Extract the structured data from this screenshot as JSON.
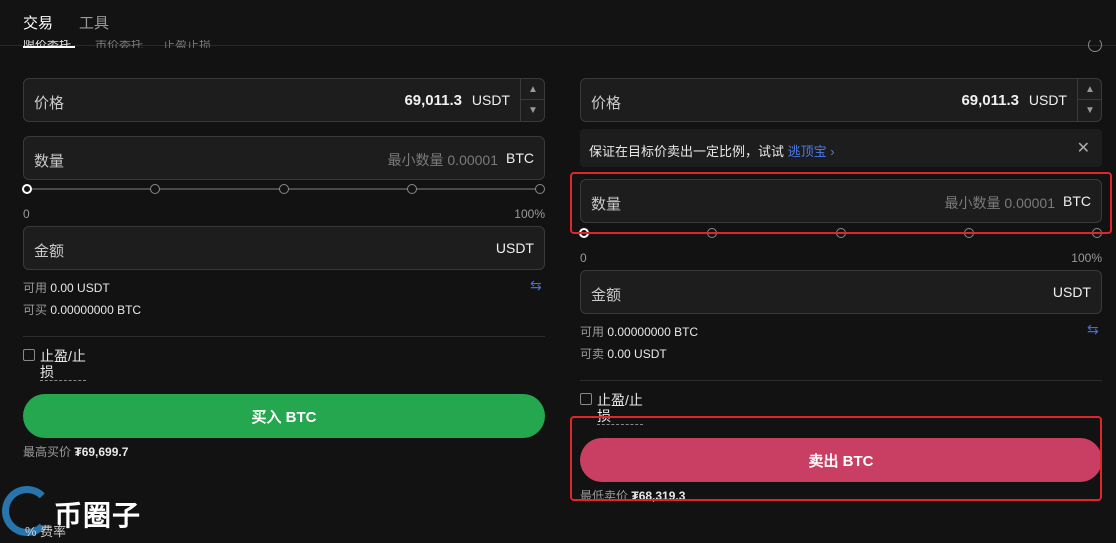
{
  "top_tabs": [
    "交易",
    "工具"
  ],
  "sub_tabs": [
    "限价委托",
    "市价委托",
    "止盈止损"
  ],
  "buy": {
    "price_label": "价格",
    "price_value": "69,011.3",
    "price_unit": "USDT",
    "qty_label": "数量",
    "qty_placeholder": "最小数量 0.00001",
    "qty_unit": "BTC",
    "slider_min": "0",
    "slider_max": "100%",
    "amount_label": "金额",
    "amount_unit": "USDT",
    "available_label": "可用",
    "available_value": "0.00 USDT",
    "can_buy_label": "可买",
    "can_buy_value": "0.00000000 BTC",
    "tpsl_label": "止盈/止损",
    "button_label": "买入 BTC",
    "best_label": "最高买价",
    "best_value": "₮69,699.7"
  },
  "sell": {
    "price_label": "价格",
    "price_value": "69,011.3",
    "price_unit": "USDT",
    "banner_text": "保证在目标价卖出一定比例，试试",
    "banner_link": "逃顶宝",
    "qty_label": "数量",
    "qty_placeholder": "最小数量 0.00001",
    "qty_unit": "BTC",
    "slider_min": "0",
    "slider_max": "100%",
    "amount_label": "金额",
    "amount_unit": "USDT",
    "available_label": "可用",
    "available_value": "0.00000000 BTC",
    "can_sell_label": "可卖",
    "can_sell_value": "0.00 USDT",
    "tpsl_label": "止盈/止损",
    "button_label": "卖出 BTC",
    "best_label": "最低卖价",
    "best_value": "₮68,319.3"
  },
  "watermark_text": "币圈子",
  "fee_label": "% 费率",
  "colors": {
    "buy": "#25a750",
    "sell": "#c93f63",
    "link": "#4b7bec",
    "highlight": "#e0262a"
  }
}
